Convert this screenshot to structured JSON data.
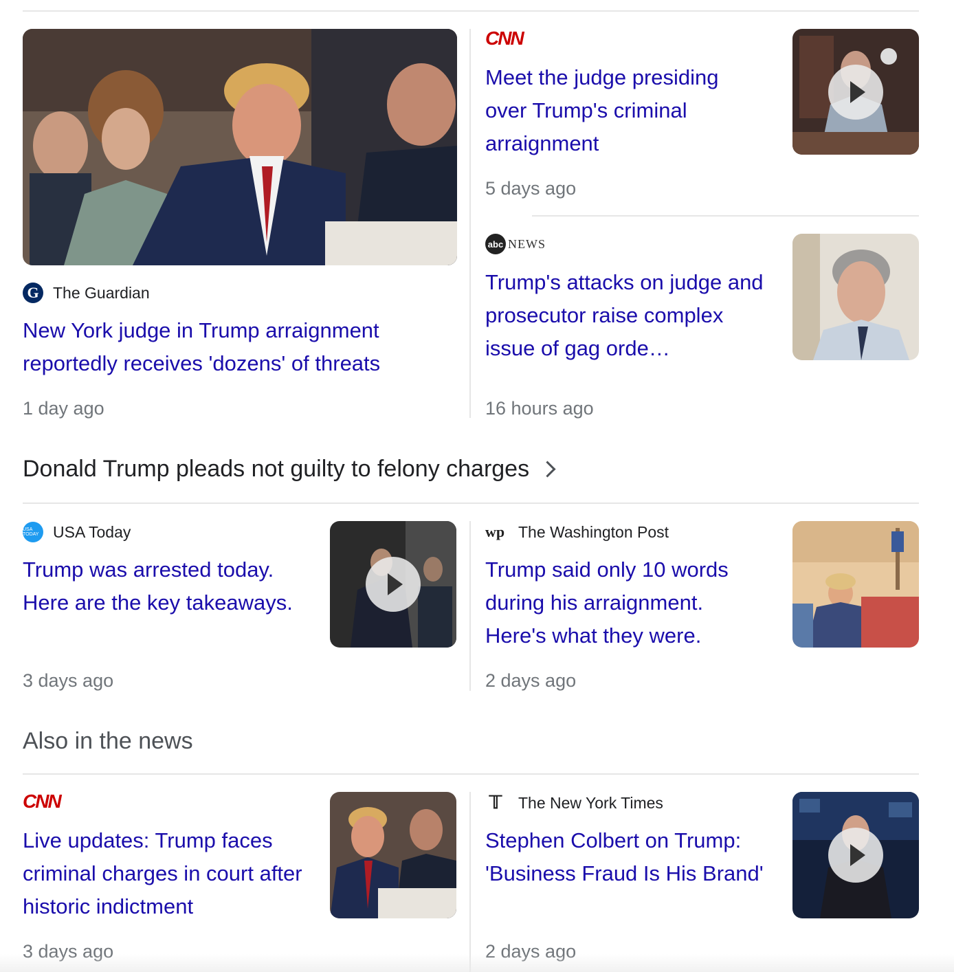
{
  "top_story": {
    "main": {
      "source": "The Guardian",
      "source_icon": "guardian-g-icon",
      "title": "New York judge in Trump arraignment reportedly receives 'dozens' of threats",
      "time": "1 day ago"
    },
    "side1": {
      "source": "CNN",
      "title": "Meet the judge presiding over Trump's criminal arraignment",
      "time": "5 days ago",
      "has_video": true
    },
    "side2": {
      "source_logo_circle": "abc",
      "source_logo_text": "NEWS",
      "title": "Trump's attacks on judge and prosecutor raise complex issue of gag orde…",
      "time": "16 hours ago"
    }
  },
  "section1": {
    "heading": "Donald Trump pleads not guilty to felony charges",
    "articles": [
      {
        "source": "USA Today",
        "source_icon_text": "USA TODAY",
        "title": "Trump was arrested today. Here are the key takeaways.",
        "time": "3 days ago",
        "has_video": true
      },
      {
        "source": "The Washington Post",
        "source_icon_text": "wp",
        "title": "Trump said only 10 words during his arraignment. Here's what they were.",
        "time": "2 days ago"
      }
    ]
  },
  "section2": {
    "heading": "Also in the news",
    "articles": [
      {
        "source": "CNN",
        "title": "Live updates: Trump faces criminal charges in court after historic indictment",
        "time": "3 days ago"
      },
      {
        "source": "The New York Times",
        "source_icon_text": "𝕋",
        "title": "Stephen Colbert on Trump: 'Business Fraud Is His Brand'",
        "time": "2 days ago",
        "has_video": true
      }
    ]
  },
  "colors": {
    "link": "#1a0dab",
    "meta": "#70757a",
    "divider": "#e6e6e6",
    "cnn_red": "#cc0000"
  }
}
